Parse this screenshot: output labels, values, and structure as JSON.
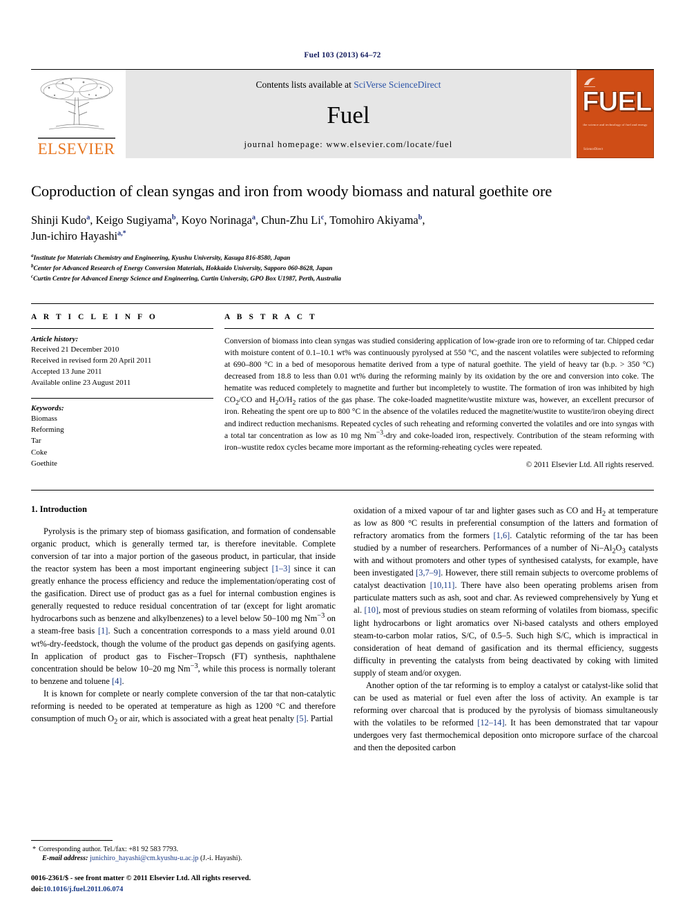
{
  "running_head": "Fuel 103 (2013) 64–72",
  "masthead": {
    "publisher_name": "ELSEVIER",
    "contents_prefix": "Contents lists available at ",
    "contents_link": "SciVerse ScienceDirect",
    "journal_name": "Fuel",
    "homepage": "journal homepage: www.elsevier.com/locate/fuel",
    "cover_title": "FUEL",
    "cover_tagline": "the science and technology of fuel and energy",
    "cover_footer": "ScienceDirect"
  },
  "article": {
    "title": "Coproduction of clean syngas and iron from woody biomass and natural goethite ore",
    "authors_line_1": "Shinji Kudo a, Keigo Sugiyama b, Koyo Norinaga a, Chun-Zhu Li c, Tomohiro Akiyama b,",
    "authors_line_2": "Jun-ichiro Hayashi a,*",
    "authors": [
      {
        "name": "Shinji Kudo",
        "sup": "a",
        "sep": ", "
      },
      {
        "name": "Keigo Sugiyama",
        "sup": "b",
        "sep": ", "
      },
      {
        "name": "Koyo Norinaga",
        "sup": "a",
        "sep": ", "
      },
      {
        "name": "Chun-Zhu Li",
        "sup": "c",
        "sep": ", "
      },
      {
        "name": "Tomohiro Akiyama",
        "sup": "b",
        "sep": ","
      }
    ],
    "author_last": {
      "name": "Jun-ichiro Hayashi",
      "sup": "a,*"
    },
    "affiliations": [
      {
        "label": "a",
        "text": "Institute for Materials Chemistry and Engineering, Kyushu University, Kasuga 816-8580, Japan"
      },
      {
        "label": "b",
        "text": "Center for Advanced Research of Energy Conversion Materials, Hokkaido University, Sapporo 060-8628, Japan"
      },
      {
        "label": "c",
        "text": "Curtin Centre for Advanced Energy Science and Engineering, Curtin University, GPO Box U1987, Perth, Australia"
      }
    ]
  },
  "article_info": {
    "heading": "A R T I C L E    I N F O",
    "history_title": "Article history:",
    "history": [
      "Received 21 December 2010",
      "Received in revised form 20 April 2011",
      "Accepted 13 June 2011",
      "Available online 23 August 2011"
    ],
    "keywords_title": "Keywords:",
    "keywords": [
      "Biomass",
      "Reforming",
      "Tar",
      "Coke",
      "Goethite"
    ]
  },
  "abstract": {
    "heading": "A B S T R A C T",
    "copyright": "© 2011 Elsevier Ltd. All rights reserved."
  },
  "intro": {
    "heading": "1. Introduction"
  },
  "footnote": {
    "star": "*",
    "corresponding": "Corresponding author. Tel./fax: +81 92 583 7793.",
    "email_label": "E-mail address:",
    "email": "junichiro_hayashi@cm.kyushu-u.ac.jp",
    "email_suffix": "(J.-i. Hayashi).",
    "issn_line": "0016-2361/$ - see front matter © 2011 Elsevier Ltd. All rights reserved.",
    "doi_label": "doi:",
    "doi": "10.1016/j.fuel.2011.06.074"
  },
  "colors": {
    "elsevier_orange": "#E87722",
    "cover_orange": "#cf4d16",
    "link_blue": "#1a3a86",
    "running_head_blue": "#111a5c"
  }
}
